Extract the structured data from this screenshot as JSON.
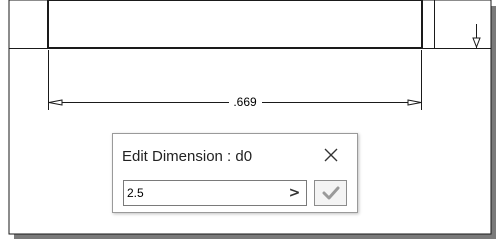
{
  "drawing": {
    "dimension_text": ".669"
  },
  "dialog": {
    "title": "Edit Dimension : d0",
    "input_value": "2.5",
    "arrow_glyph": ">",
    "close_glyph": "×"
  },
  "icons": {
    "close": "close-icon",
    "arrow": "chevron-right-icon",
    "accept": "checkmark-icon"
  },
  "colors": {
    "drawing_line": "#1a1a1a",
    "accept_check": "#9a9a9a",
    "dialog_border": "#9a9a9a"
  }
}
